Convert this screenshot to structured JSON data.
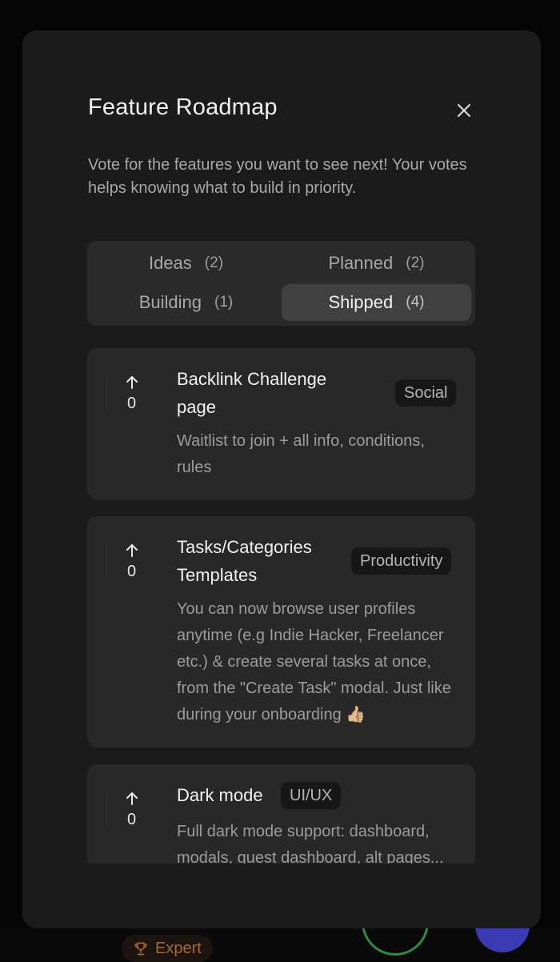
{
  "modal": {
    "title": "Feature Roadmap",
    "subtitle": "Vote for the features you want to see next! Your votes helps knowing what to build in priority."
  },
  "tabs": [
    {
      "label": "Ideas",
      "count": "(2)",
      "active": false
    },
    {
      "label": "Planned",
      "count": "(2)",
      "active": false
    },
    {
      "label": "Building",
      "count": "(1)",
      "active": false
    },
    {
      "label": "Shipped",
      "count": "(4)",
      "active": true
    }
  ],
  "features": [
    {
      "votes": "0",
      "title_line1": "Backlink Challenge",
      "title_line2": "page",
      "tag": "Social",
      "description": "Waitlist to join + all info, conditions, rules"
    },
    {
      "votes": "0",
      "title_line1": "Tasks/Categories",
      "title_line2": "Templates",
      "tag": "Productivity",
      "description": "You can now browse user profiles anytime (e.g Indie Hacker, Freelancer etc.) & create several tasks at once, from the \"Create Task\" modal. Just like during your onboarding 👍🏼"
    },
    {
      "votes": "0",
      "title_line1": "Dark mode",
      "tag": "UI/UX",
      "description": "Full dark mode support: dashboard, modals, guest dashboard, alt pages..."
    }
  ],
  "background": {
    "badge_label": "Expert"
  },
  "colors": {
    "modal_bg": "#1b1b1b",
    "card_bg": "#282828",
    "active_tab": "#404040",
    "badge_accent": "#a9692f",
    "ring_accent": "#2f8a42",
    "fab_accent": "#3c3ab3"
  }
}
